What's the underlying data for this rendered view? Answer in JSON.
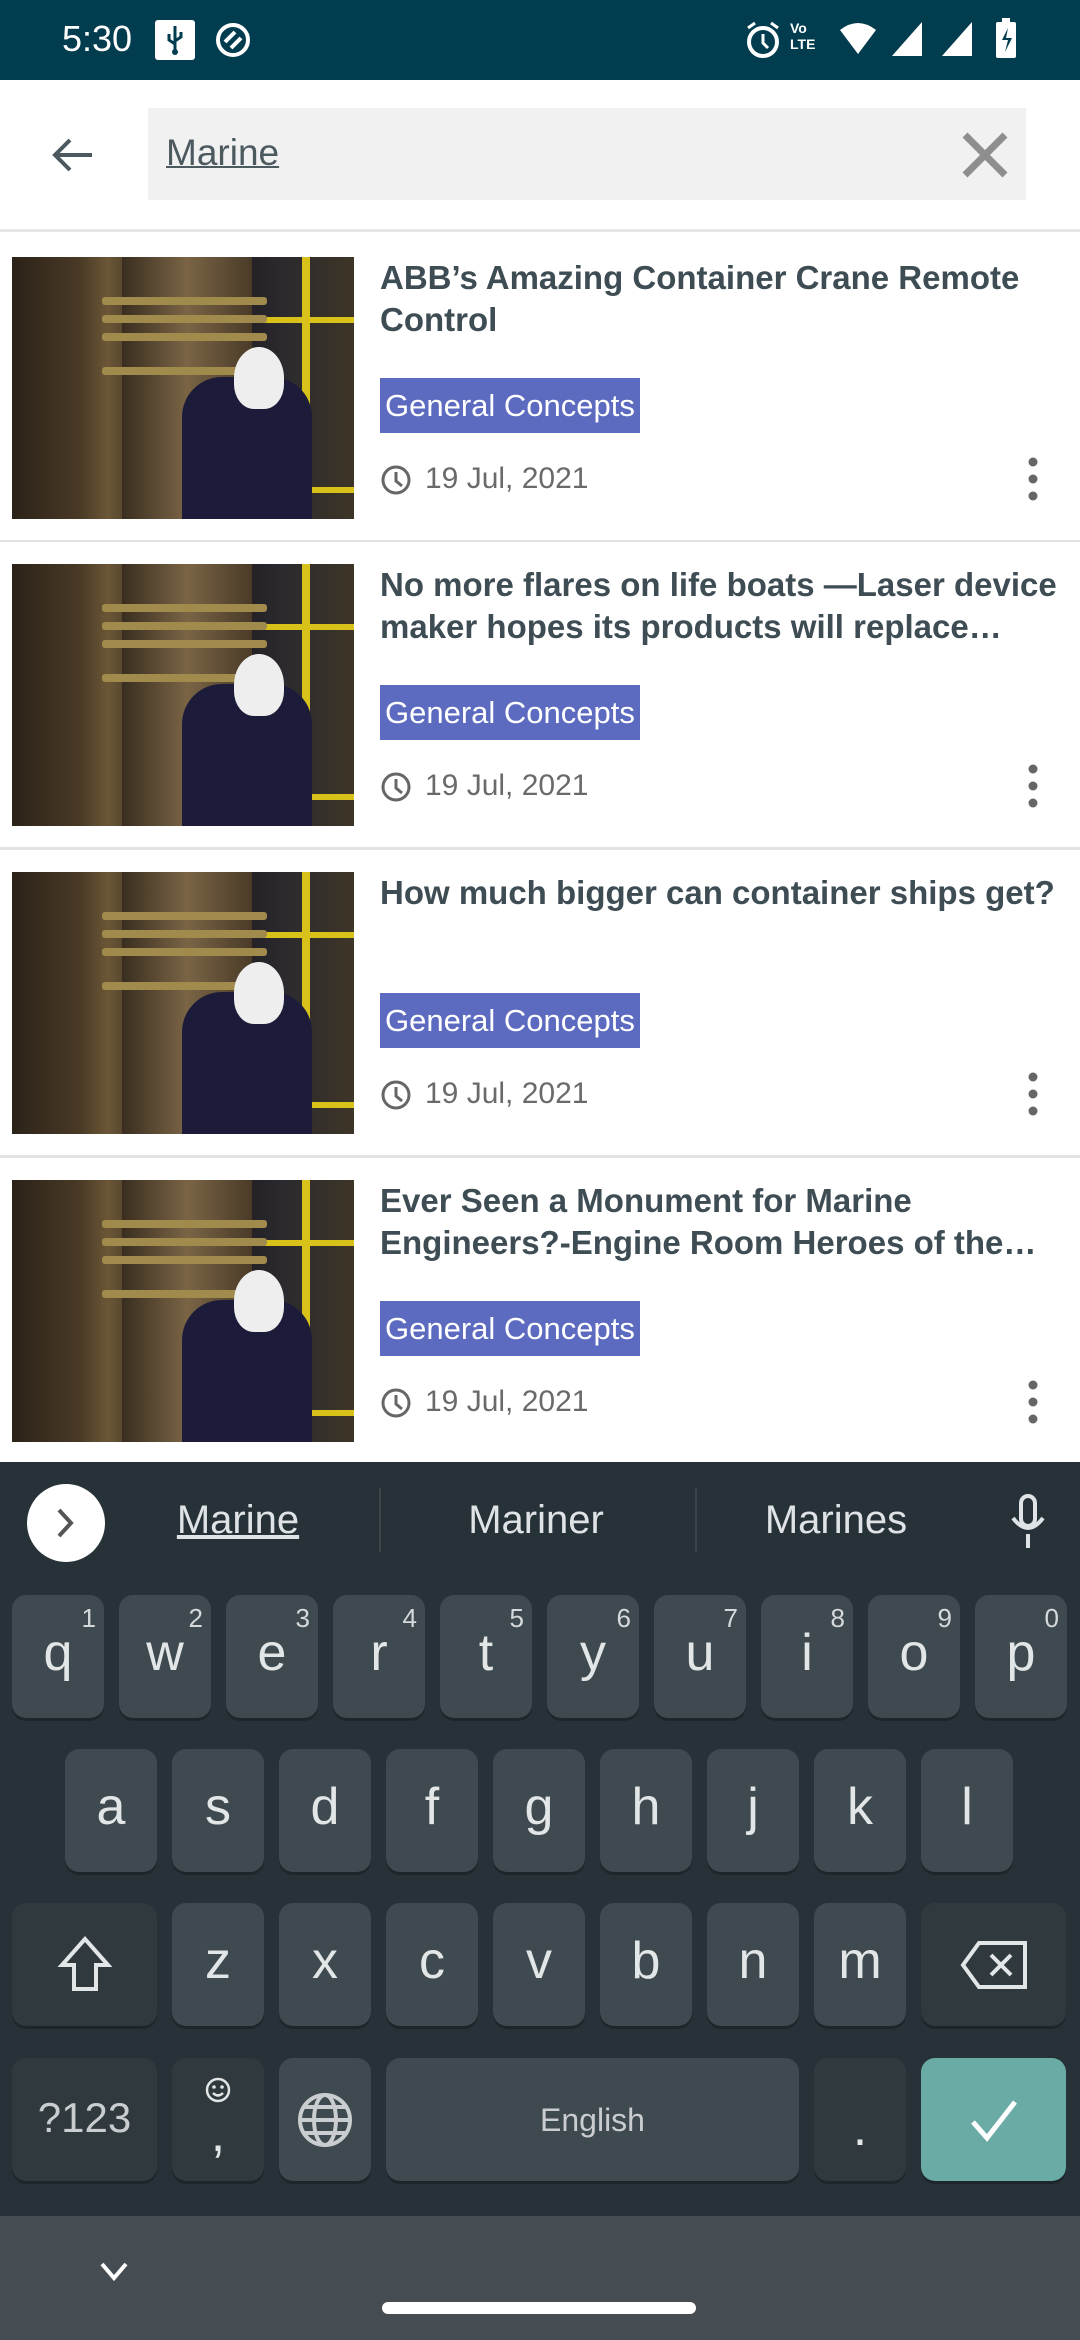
{
  "status_bar": {
    "time": "5:30",
    "icons": [
      "usb-icon",
      "data-saver-icon",
      "alarm-icon",
      "volte-icon",
      "wifi-icon",
      "signal-icon",
      "signal-icon",
      "battery-charging-icon"
    ]
  },
  "search": {
    "value": "Marine",
    "back_icon": "arrow-left-icon",
    "clear_icon": "close-icon"
  },
  "colors": {
    "status_bar": "#023d4f",
    "tag": "#5c6bc0",
    "keyboard_bg": "#263238",
    "enter_key": "#6aaba5"
  },
  "articles": [
    {
      "title": "ABB’s Amazing Container Crane Remote Control",
      "tag": "General Concepts",
      "date": "19 Jul, 2021"
    },
    {
      "title": "No more flares on life boats —Laser device maker hopes its products will replace flares",
      "tag": "General Concepts",
      "date": "19 Jul, 2021"
    },
    {
      "title": "How much bigger can container ships get?",
      "tag": "General Concepts",
      "date": "19 Jul, 2021"
    },
    {
      "title": "Ever Seen a Monument for Marine Engineers?-Engine Room Heroes of the Titanic",
      "tag": "General Concepts",
      "date": "19 Jul, 2021"
    }
  ],
  "keyboard": {
    "suggestions": [
      "Marine",
      "Mariner",
      "Marines"
    ],
    "row1": [
      {
        "k": "q",
        "n": "1"
      },
      {
        "k": "w",
        "n": "2"
      },
      {
        "k": "e",
        "n": "3"
      },
      {
        "k": "r",
        "n": "4"
      },
      {
        "k": "t",
        "n": "5"
      },
      {
        "k": "y",
        "n": "6"
      },
      {
        "k": "u",
        "n": "7"
      },
      {
        "k": "i",
        "n": "8"
      },
      {
        "k": "o",
        "n": "9"
      },
      {
        "k": "p",
        "n": "0"
      }
    ],
    "row2": [
      "a",
      "s",
      "d",
      "f",
      "g",
      "h",
      "j",
      "k",
      "l"
    ],
    "row3": [
      "z",
      "x",
      "c",
      "v",
      "b",
      "n",
      "m"
    ],
    "symbols_label": "?123",
    "comma": ",",
    "space_label": "English",
    "period": "."
  }
}
